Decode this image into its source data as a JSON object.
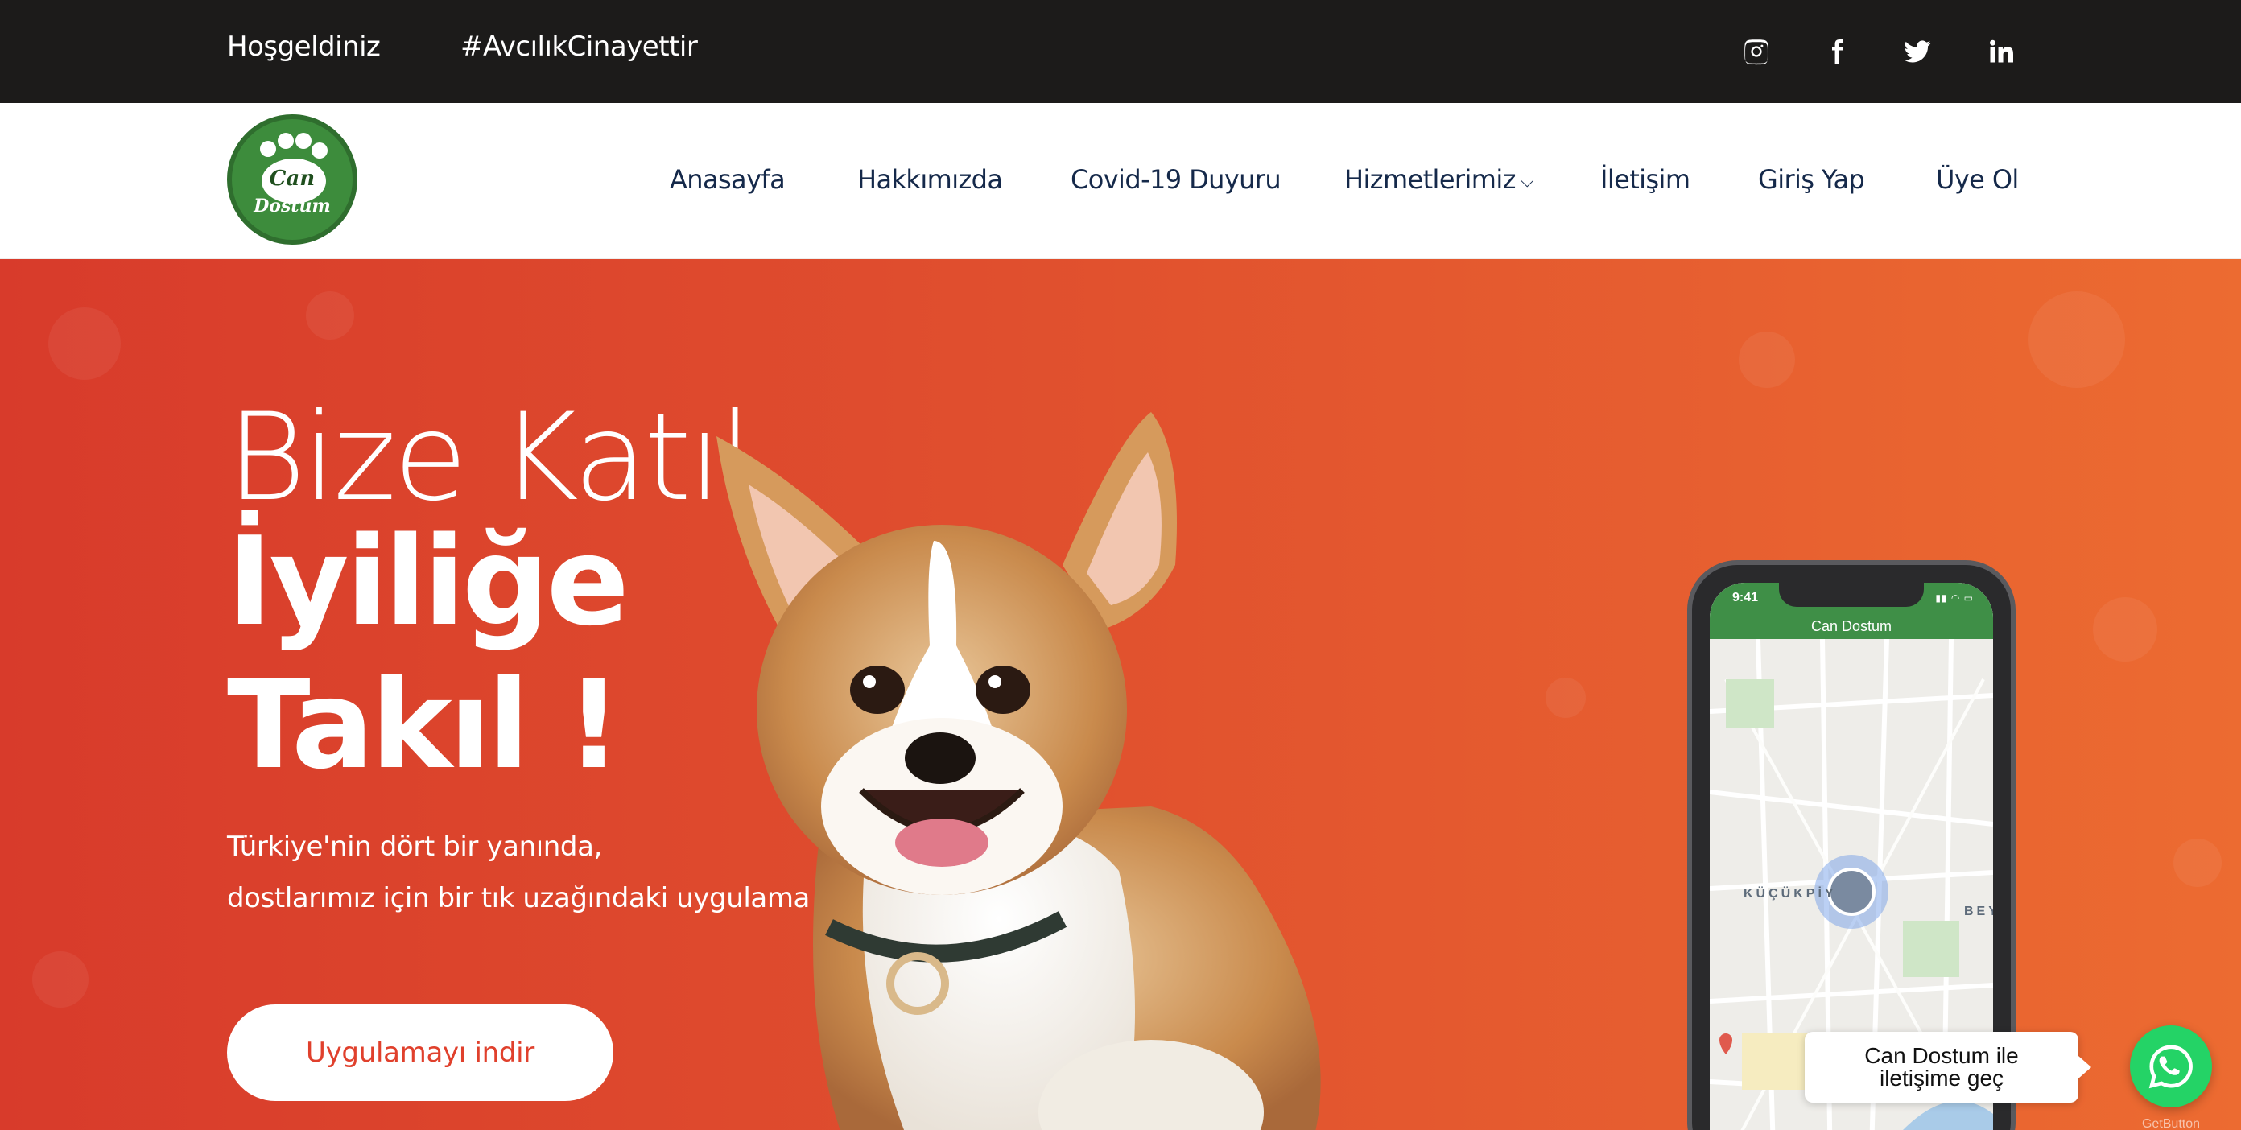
{
  "topbar": {
    "welcome": "Hoşgeldiniz",
    "hashtag": "#AvcılıkCinayettir",
    "social_icons": [
      "instagram-icon",
      "facebook-icon",
      "twitter-icon",
      "linkedin-icon"
    ]
  },
  "logo": {
    "line1": "Can",
    "line2": "Dostum"
  },
  "nav": {
    "items": [
      {
        "label": "Anasayfa"
      },
      {
        "label": "Hakkımızda"
      },
      {
        "label": "Covid-19 Duyuru"
      },
      {
        "label": "Hizmetlerimiz",
        "has_dropdown": true
      },
      {
        "label": "İletişim"
      },
      {
        "label": "Giriş Yap"
      },
      {
        "label": "Üye Ol"
      }
    ]
  },
  "hero": {
    "line1": "Bize Katıl,",
    "line2": "İyiliğe",
    "line3": "Takıl !",
    "desc1": "Türkiye'nin dört bir yanında,",
    "desc2": "dostlarımız için bir tık uzağındaki uygulama !",
    "cta_label": "Uygulamayı indir"
  },
  "phone": {
    "time": "9:41",
    "app_title": "Can Dostum",
    "map_label_1": "KÜÇÜKPİY",
    "map_label_2": "BEY"
  },
  "whatsapp": {
    "line1": "Can Dostum ile",
    "line2": "iletişime geç",
    "brand": "GetButton"
  },
  "colors": {
    "topbar_bg": "#1c1b1a",
    "nav_text": "#15294a",
    "hero_gradient_start": "#d83b2b",
    "hero_gradient_end": "#ec6b31",
    "cta_text": "#e0402c",
    "whatsapp_green": "#24d366",
    "logo_green": "#3d8c3c"
  }
}
